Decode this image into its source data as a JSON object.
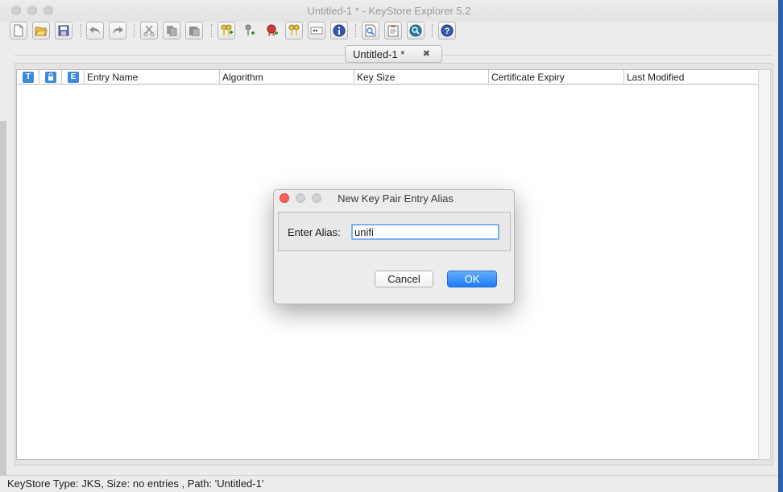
{
  "window": {
    "title": "Untitled-1 * - KeyStore Explorer 5.2"
  },
  "toolbar": {
    "buttons": [
      {
        "name": "new-icon"
      },
      {
        "name": "open-icon"
      },
      {
        "name": "save-icon"
      },
      {
        "name": "undo-icon"
      },
      {
        "name": "redo-icon"
      },
      {
        "name": "cut-icon"
      },
      {
        "name": "copy-icon"
      },
      {
        "name": "paste-icon"
      },
      {
        "name": "generate-key-pair-icon"
      },
      {
        "name": "generate-secret-key-icon"
      },
      {
        "name": "import-trusted-certificate-icon"
      },
      {
        "name": "import-key-pair-icon"
      },
      {
        "name": "set-password-icon"
      },
      {
        "name": "properties-icon"
      },
      {
        "name": "examine-file-icon"
      },
      {
        "name": "examine-clipboard-icon"
      },
      {
        "name": "examine-ssl-icon"
      },
      {
        "name": "help-icon"
      }
    ]
  },
  "tab": {
    "label": "Untitled-1 *",
    "close": "✖"
  },
  "table": {
    "icon_headers": [
      "T",
      "🔒",
      "E"
    ],
    "columns": [
      "Entry Name",
      "Algorithm",
      "Key Size",
      "Certificate Expiry",
      "Last Modified"
    ]
  },
  "dialog": {
    "title": "New Key Pair Entry Alias",
    "label": "Enter Alias:",
    "value": "unifi",
    "cancel": "Cancel",
    "ok": "OK"
  },
  "status": {
    "text": "KeyStore Type: JKS, Size: no entries , Path: 'Untitled-1'"
  },
  "colors": {
    "accent": "#1a7cf5",
    "header_icon": "#3d8bd6",
    "close_red": "#fc605c"
  }
}
